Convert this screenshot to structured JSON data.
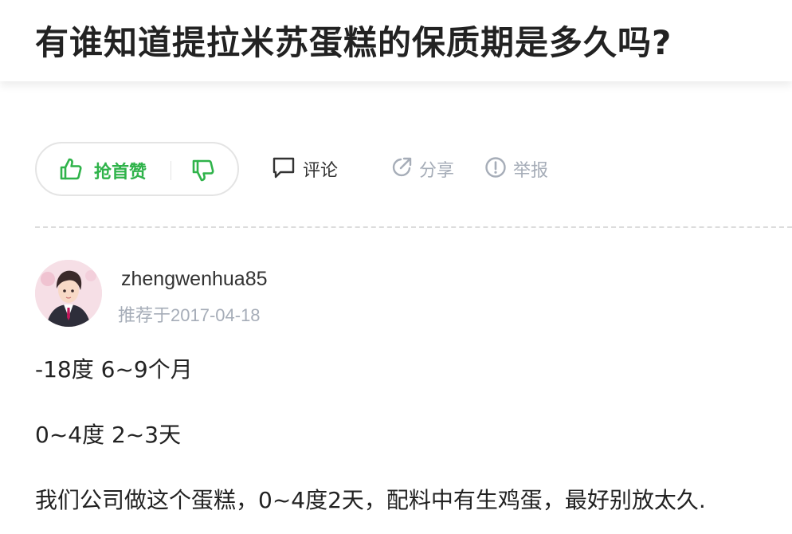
{
  "question": {
    "title": "有谁知道提拉米苏蛋糕的保质期是多久吗?"
  },
  "actions": {
    "upvote_label": "抢首赞",
    "comment_label": "评论",
    "share_label": "分享",
    "report_label": "举报"
  },
  "answer": {
    "username": "zhengwenhua85",
    "recommended": "推荐于2017-04-18",
    "paragraphs": [
      "-18度 6~9个月",
      "0~4度 2~3天",
      "我们公司做这个蛋糕，0~4度2天，配料中有生鸡蛋，最好别放太久."
    ]
  },
  "colors": {
    "accent_green": "#2fb34a",
    "muted_gray": "#a6adb8",
    "text_dark": "#222222"
  },
  "icons": [
    "thumbs-up-icon",
    "thumbs-down-icon",
    "comment-bubble-icon",
    "share-icon",
    "report-icon"
  ]
}
